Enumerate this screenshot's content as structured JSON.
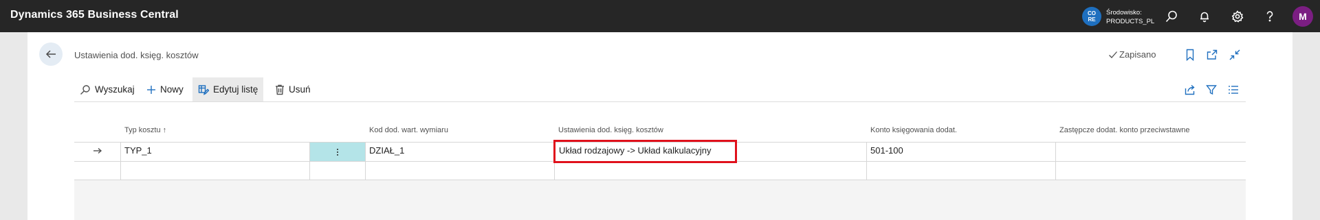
{
  "app": {
    "title": "Dynamics 365 Business Central"
  },
  "environment": {
    "badge_line1": "CO",
    "badge_line2": "RE",
    "label": "Środowisko:",
    "name": "PRODUCTS_PL"
  },
  "user": {
    "initial": "M"
  },
  "page": {
    "title": "Ustawienia dod. księg. kosztów",
    "status": "Zapisano"
  },
  "actions": {
    "search": "Wyszukaj",
    "new": "Nowy",
    "edit_list": "Edytuj listę",
    "delete": "Usuń"
  },
  "table": {
    "headers": {
      "cost_type": "Typ kosztu",
      "sort_indicator": "↑",
      "dim_value": "Kod dod. wart. wymiaru",
      "setup": "Ustawienia dod. księg. kosztów",
      "posting_account": "Konto księgowania dodat.",
      "alt_account": "Zastępcze dodat. konto przeciwstawne"
    },
    "rows": [
      {
        "cost_type": "TYP_1",
        "dim_value": "DZIAŁ_1",
        "setup": "Układ rodzajowy -> Układ kalkulacyjny",
        "posting_account": "501-100",
        "alt_account": ""
      }
    ]
  },
  "colors": {
    "appbar": "#262626",
    "accent": "#1e6fbf",
    "selected_cell": "#b4e4e8",
    "highlight": "#e0101b",
    "avatar": "#7b1e82"
  }
}
